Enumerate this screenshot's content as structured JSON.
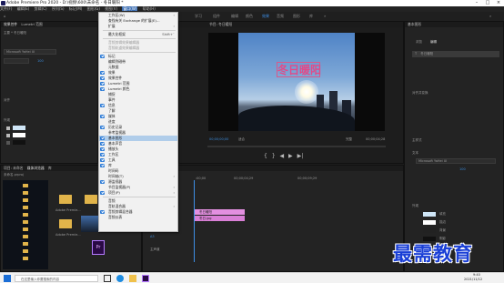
{
  "window": {
    "title": "Adobe Premiere Pro 2020 - D:\\视频\\600\\未命名 - 冬日暖阳 *"
  },
  "menubar": {
    "items": [
      "文件(F)",
      "编辑(E)",
      "剪辑(C)",
      "序列(S)",
      "标记(M)",
      "图形(G)",
      "视图(V)",
      "窗口(W)",
      "帮助(H)"
    ]
  },
  "workspaces": {
    "items": [
      "学习",
      "组件",
      "编辑",
      "颜色",
      "效果",
      "音频",
      "图形",
      "库"
    ],
    "active_index": 4
  },
  "window_menu": {
    "items": [
      {
        "label": "工作区(W)",
        "shortcut": "",
        "checked": false,
        "disabled": false,
        "highlight": false
      },
      {
        "label": "查找有关 Exchange 的扩展(E)...",
        "shortcut": "",
        "checked": false,
        "disabled": false,
        "highlight": false
      },
      {
        "label": "扩展",
        "shortcut": "",
        "checked": false,
        "disabled": false,
        "highlight": false
      },
      {
        "label": "最大化框架",
        "shortcut": "Shift+`",
        "checked": false,
        "disabled": false,
        "highlight": false
      },
      {
        "label": "音频剪辑效果编辑器",
        "shortcut": "",
        "checked": false,
        "disabled": true,
        "highlight": false
      },
      {
        "label": "音频轨道效果编辑器",
        "shortcut": "",
        "checked": false,
        "disabled": true,
        "highlight": false
      },
      {
        "label": "标记",
        "shortcut": "",
        "checked": true,
        "disabled": false,
        "highlight": false
      },
      {
        "label": "编辑到磁带",
        "shortcut": "",
        "checked": false,
        "disabled": false,
        "highlight": false
      },
      {
        "label": "元数据",
        "shortcut": "",
        "checked": false,
        "disabled": false,
        "highlight": false
      },
      {
        "label": "效果",
        "shortcut": "",
        "checked": true,
        "disabled": false,
        "highlight": false
      },
      {
        "label": "效果控件",
        "shortcut": "",
        "checked": true,
        "disabled": false,
        "highlight": false
      },
      {
        "label": "Lumetri 范围",
        "shortcut": "",
        "checked": true,
        "disabled": false,
        "highlight": false
      },
      {
        "label": "Lumetri 颜色",
        "shortcut": "",
        "checked": true,
        "disabled": false,
        "highlight": false
      },
      {
        "label": "捕捉",
        "shortcut": "",
        "checked": false,
        "disabled": false,
        "highlight": false
      },
      {
        "label": "事件",
        "shortcut": "",
        "checked": false,
        "disabled": false,
        "highlight": false
      },
      {
        "label": "信息",
        "shortcut": "",
        "checked": true,
        "disabled": false,
        "highlight": false
      },
      {
        "label": "了解",
        "shortcut": "",
        "checked": false,
        "disabled": false,
        "highlight": false
      },
      {
        "label": "媒体",
        "shortcut": "",
        "checked": true,
        "disabled": false,
        "highlight": false
      },
      {
        "label": "进度",
        "shortcut": "",
        "checked": false,
        "disabled": false,
        "highlight": false
      },
      {
        "label": "历史记录",
        "shortcut": "",
        "checked": true,
        "disabled": false,
        "highlight": false
      },
      {
        "label": "参考监视器",
        "shortcut": "",
        "checked": false,
        "disabled": false,
        "highlight": false
      },
      {
        "label": "基本图形",
        "shortcut": "",
        "checked": true,
        "disabled": false,
        "highlight": true
      },
      {
        "label": "基本声音",
        "shortcut": "",
        "checked": true,
        "disabled": false,
        "highlight": false
      },
      {
        "label": "播放头",
        "shortcut": "",
        "checked": true,
        "disabled": false,
        "highlight": false
      },
      {
        "label": "工作区",
        "shortcut": "",
        "checked": true,
        "disabled": false,
        "highlight": false
      },
      {
        "label": "工具",
        "shortcut": "",
        "checked": true,
        "disabled": false,
        "highlight": false
      },
      {
        "label": "库",
        "shortcut": "",
        "checked": true,
        "disabled": false,
        "highlight": false
      },
      {
        "label": "时间码",
        "shortcut": "",
        "checked": false,
        "disabled": false,
        "highlight": false
      },
      {
        "label": "时间轴(T)",
        "shortcut": "",
        "checked": false,
        "disabled": false,
        "highlight": false
      },
      {
        "label": "源监视器",
        "shortcut": "",
        "checked": true,
        "disabled": false,
        "highlight": false
      },
      {
        "label": "节目监视器(P)",
        "shortcut": "",
        "checked": false,
        "disabled": false,
        "highlight": false
      },
      {
        "label": "项目(P)",
        "shortcut": "",
        "checked": true,
        "disabled": false,
        "highlight": false
      },
      {
        "label": "音频",
        "shortcut": "",
        "checked": false,
        "disabled": false,
        "highlight": false
      },
      {
        "label": "音轨混合器",
        "shortcut": "",
        "checked": false,
        "disabled": false,
        "highlight": false
      },
      {
        "label": "音频剪辑混合器",
        "shortcut": "",
        "checked": true,
        "disabled": false,
        "highlight": false
      },
      {
        "label": "音频仪表",
        "shortcut": "",
        "checked": false,
        "disabled": false,
        "highlight": false
      }
    ]
  },
  "left_top_panel": {
    "tabs": [
      "效果控件",
      "Lumetri 范围",
      "源: (无剪辑)",
      "音频剪辑混合器"
    ],
    "master": "主要 * 冬日暖阳",
    "font": "Microsoft YaHei UI",
    "font_size": "100",
    "section_align": "对齐",
    "section_appearance": "外观"
  },
  "program_monitor": {
    "tab": "节目: 冬日暖阳",
    "title_text": "冬日暖阳",
    "timecode_left": "00;00;00;00",
    "fit": "适合",
    "quality": "完整",
    "timecode_right": "00;00;04;28"
  },
  "right_panel": {
    "tabs": [
      "基本图形",
      "浏览",
      "编辑"
    ],
    "layer": "冬日暖阳",
    "section_align": "对齐并变换",
    "section_style": "主样式",
    "font": "Microsoft YaHei UI",
    "font_size": "100",
    "section_text": "文本",
    "section_appearance": "外观",
    "appearance_rows": [
      "填充",
      "描边",
      "背景",
      "阴影"
    ]
  },
  "project_panel": {
    "tabs": [
      "项目: 未命名",
      "媒体浏览器",
      "库",
      "信息"
    ],
    "path": "未命名.prproj",
    "sidebar_items": [
      "收藏夹",
      "本地驱动器",
      "C:",
      "D:",
      "E:",
      "F:",
      "G:",
      "网络驱动器",
      "Creative Cloud"
    ],
    "thumb_labels": [
      "未命名.mp4",
      "Adobe Premie...",
      "Adobe Premie...",
      "冬日暖阳.jpg",
      "Adobe Premie...",
      "冬日暖阳"
    ]
  },
  "timeline": {
    "tab": "冬日暖阳",
    "timecode": "00;00;00;00",
    "ruler_start": ":00;00",
    "ruler_mid": "00;00;04;29",
    "ruler_end": "00;00;09;29",
    "tracks": [
      "V3",
      "V2",
      "V1",
      "A1",
      "A2",
      "A3"
    ],
    "clip_top": "冬日暖阳",
    "clip_bottom": "冬日.jpg",
    "master_label": "主声道"
  },
  "taskbar": {
    "search": "在这里输入你要搜索的内容",
    "time": "9:40",
    "date": "2021/11/12"
  },
  "watermark": "最需教育",
  "colors": {
    "accent": "#3e8fe6",
    "clip_pink": "#e38fe0",
    "title_pink": "#e24a88",
    "menu_highlight": "#b0cdea"
  }
}
